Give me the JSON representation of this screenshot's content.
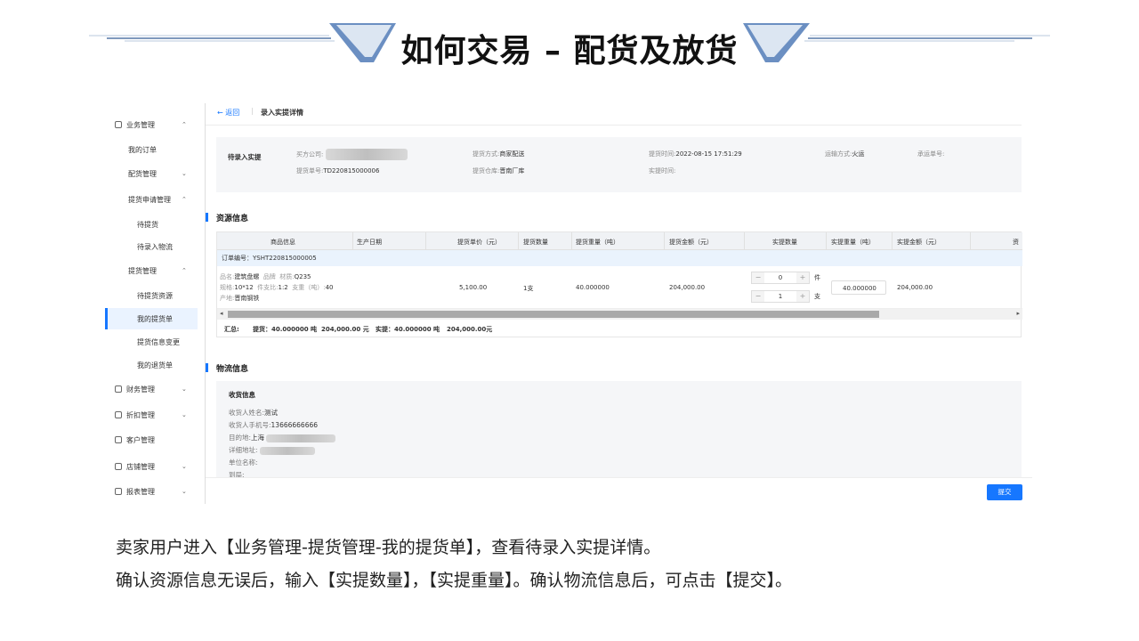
{
  "slide": {
    "title": "如何交易 – 配货及放货",
    "desc_line1": "卖家用户进入【业务管理-提货管理-我的提货单】，查看待录入实提详情。",
    "desc_line2": "确认资源信息无误后，输入【实提数量】，【实提重量】。确认物流信息后，可点击【提交】。"
  },
  "sidebar": {
    "items": [
      {
        "label": "业务管理",
        "expanded": true
      },
      {
        "label": "我的订单"
      },
      {
        "label": "配货管理",
        "expanded": false
      },
      {
        "label": "提货申请管理",
        "expanded": true
      },
      {
        "label": "待提货"
      },
      {
        "label": "待录入物流"
      },
      {
        "label": "提货管理",
        "expanded": true
      },
      {
        "label": "待提货资源"
      },
      {
        "label": "我的提货单",
        "active": true
      },
      {
        "label": "提货信息变更"
      },
      {
        "label": "我的退货单"
      },
      {
        "label": "财务管理",
        "expanded": false
      },
      {
        "label": "折扣管理",
        "expanded": false
      },
      {
        "label": "客户管理"
      },
      {
        "label": "店铺管理",
        "expanded": false
      },
      {
        "label": "报表管理",
        "expanded": false
      }
    ]
  },
  "topbar": {
    "back": "返回",
    "crumb": "录入实提详情"
  },
  "info": {
    "status": "待录入实提",
    "buyer_label": "买方公司:",
    "pickup_no_label": "提货单号:",
    "pickup_no": "TD220815000006",
    "pickup_method_label": "提货方式:",
    "pickup_method": "商家配送",
    "warehouse_label": "提货仓库:",
    "warehouse": "晋南厂库",
    "pickup_time_label": "提货时间:",
    "pickup_time": "2022-08-15 17:51:29",
    "actual_time_label": "实提时间:",
    "transport_label": "运输方式:",
    "transport": "火运",
    "carrier_label": "承运单号:"
  },
  "resource": {
    "title": "资源信息",
    "columns": [
      "商品信息",
      "生产日期",
      "提货单价（元）",
      "提货数量",
      "提货重量（吨）",
      "提货金额（元）",
      "实提数量",
      "实提重量（吨）",
      "实提金额（元）",
      "资"
    ],
    "order_no": "订单编号：YSHT220815000005",
    "row": {
      "name_k": "品名:",
      "name": "建筑盘螺",
      "brand_k": "品牌",
      "material_k": "材质:",
      "material": "Q235",
      "spec_k": "规格:",
      "spec": "10*12",
      "pieces_k": "件支比:",
      "pieces": "1:2",
      "branch_k": "支重（吨）:",
      "branch": "40",
      "origin_k": "产地:",
      "origin": "晋南钢铁",
      "unit_price": "5,100.00",
      "qty": "1支",
      "weight": "40.000000",
      "amount": "204,000.00",
      "actual_qty_a": "0",
      "unit_a": "件",
      "actual_qty_b": "1",
      "unit_b": "支",
      "actual_weight": "40.000000",
      "actual_amount": "204,000.00"
    },
    "summary": {
      "label": "汇总:",
      "pickup": "提货：40.000000 吨",
      "pickup_amount": "204,000.00 元",
      "actual": "实提：40.000000 吨",
      "actual_amount": "204,000.00元"
    }
  },
  "logistics": {
    "title": "物流信息",
    "sub": "收货信息",
    "name_k": "收货人姓名:",
    "name": "测试",
    "phone_k": "收货人手机号:",
    "phone": "13666666666",
    "dest_k": "目的地:",
    "dest": "上海",
    "addr_k": "详细地址:",
    "company_k": "单位名称:",
    "station_k": "到局:"
  },
  "footer": {
    "submit": "提交"
  },
  "colors": {
    "primary": "#1677ff",
    "header_bg": "#f0f2f5",
    "order_row_bg": "#eaf3fd",
    "panel_bg": "#f5f6f8"
  }
}
